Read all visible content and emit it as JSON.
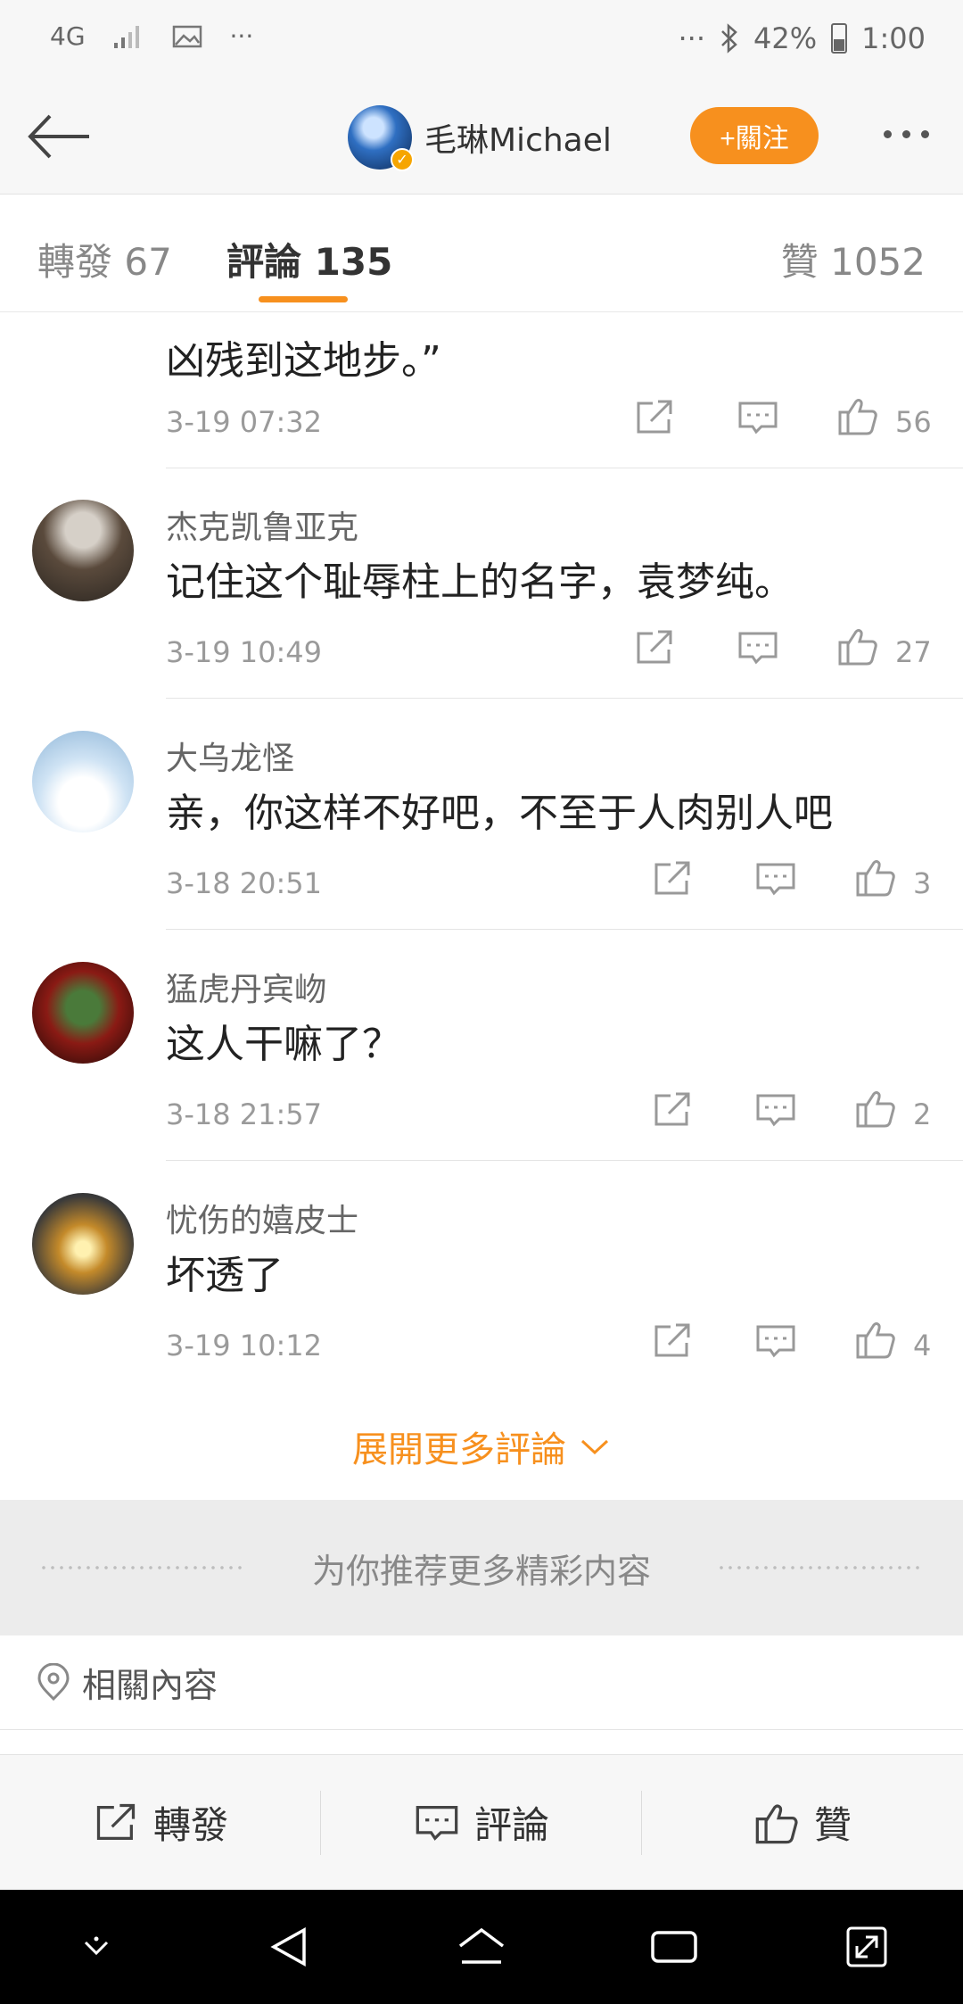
{
  "status_bar": {
    "network": "4G",
    "dots_left": "···",
    "dots_right": "···",
    "battery": "42%",
    "time": "1:00"
  },
  "header": {
    "username": "毛琳Michael",
    "follow_label": "+關注"
  },
  "tabs": {
    "reposts": "轉發 67",
    "comments": "評論 135",
    "likes": "贊 1052"
  },
  "comments": [
    {
      "author": "",
      "text": "凶残到这地步。”",
      "time": "3-19 07:32",
      "likes": "56"
    },
    {
      "author": "杰克凯鲁亚克",
      "text": "记住这个耻辱柱上的名字，袁梦纯。",
      "time": "3-19 10:49",
      "likes": "27"
    },
    {
      "author": "大乌龙怪",
      "text": "亲，你这样不好吧，不至于人肉别人吧",
      "time": "3-18 20:51",
      "likes": "3"
    },
    {
      "author": "猛虎丹宾岉",
      "text": "这人干嘛了？",
      "time": "3-18 21:57",
      "likes": "2"
    },
    {
      "author": "忧伤的嬉皮士",
      "text": "坏透了",
      "time": "3-19 10:12",
      "likes": "4"
    }
  ],
  "expand_label": "展開更多評論",
  "recommend_label": "为你推荐更多精彩内容",
  "related_label": "相關內容",
  "action_bar": {
    "repost": "轉發",
    "comment": "評論",
    "like": "贊"
  },
  "colors": {
    "accent": "#f7901e",
    "text_primary": "#222222",
    "text_secondary": "#9a9a9a"
  }
}
